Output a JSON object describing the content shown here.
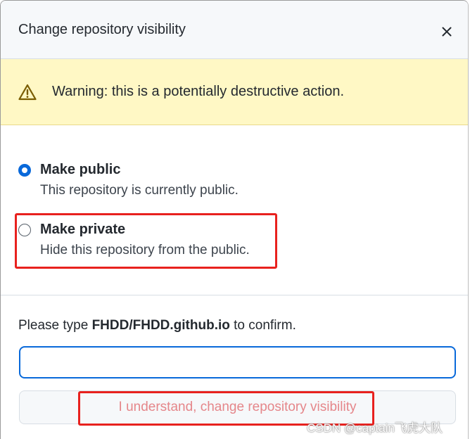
{
  "dialog": {
    "title": "Change repository visibility",
    "close_icon": "close-icon"
  },
  "warning": {
    "icon": "alert-triangle-icon",
    "text": "Warning: this is a potentially destructive action.",
    "background": "#fff8c5"
  },
  "options": [
    {
      "label": "Make public",
      "description": "This repository is currently public.",
      "selected": true
    },
    {
      "label": "Make private",
      "description": "Hide this repository from the public.",
      "selected": false
    }
  ],
  "confirm": {
    "prefix": "Please type ",
    "repo_name": "FHDD/FHDD.github.io",
    "suffix": " to confirm.",
    "input_value": "",
    "button_label": "I understand, change repository visibility"
  },
  "watermark": "CSDN @captain飞虎大队",
  "colors": {
    "accent": "#0969da",
    "annotation": "#e8211e",
    "danger_text": "#e5868a"
  }
}
